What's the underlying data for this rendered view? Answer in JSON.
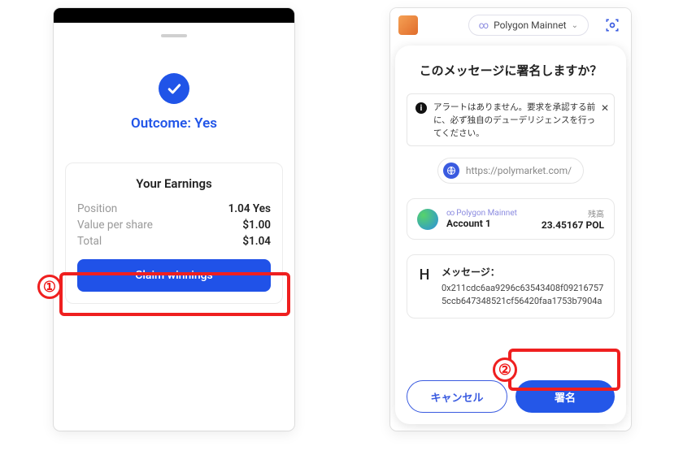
{
  "left": {
    "outcome": "Outcome: Yes",
    "earnings_title": "Your Earnings",
    "rows": [
      {
        "label": "Position",
        "value": "1.04 Yes"
      },
      {
        "label": "Value per share",
        "value": "$1.00"
      },
      {
        "label": "Total",
        "value": "$1.04"
      }
    ],
    "claim_label": "Claim winnings"
  },
  "right": {
    "network_name": "Polygon Mainnet",
    "modal_title": "このメッセージに署名しますか？",
    "alert_text": "アラートはありません。要求を承認する前に、必ず独自のデューデリジェンスを行ってください。",
    "origin_url": "https://polymarket.com/",
    "account": {
      "net_link": "Polygon Mainnet",
      "name": "Account 1",
      "balance_label": "残高",
      "balance_value": "23.45167 POL"
    },
    "message": {
      "label": "メッセージ：",
      "hex": "0x211cdc6aa9296c63543408f092167575ccb647348521cf56420faa1753b7904a"
    },
    "cancel_label": "キャンセル",
    "sign_label": "署名"
  },
  "annotations": {
    "badge1": "①",
    "badge2": "②"
  }
}
